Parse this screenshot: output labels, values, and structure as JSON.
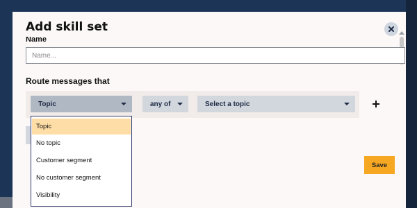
{
  "modal": {
    "title": "Add skill set",
    "close_icon": "close-icon"
  },
  "name_field": {
    "label": "Name",
    "placeholder": "Name...",
    "value": ""
  },
  "routing": {
    "label": "Route messages that",
    "condition_type": {
      "selected": "Topic",
      "icon": "chevron-down-icon"
    },
    "match_mode": {
      "selected": "any of",
      "icon": "chevron-down-icon"
    },
    "topic_picker": {
      "placeholder": "Select a topic",
      "icon": "chevron-down-icon"
    },
    "add_icon": "plus-icon",
    "condition_options": [
      "Topic",
      "No topic",
      "Customer segment",
      "No customer segment",
      "Visibility"
    ],
    "selected_option": "Topic"
  },
  "actions": {
    "save_label": "Save"
  },
  "colors": {
    "backdrop": "#1c3557",
    "modal_bg": "#fbf8f7",
    "select_bg": "#d2d6dd",
    "highlight": "#fedda6",
    "save_bg": "#f6a823"
  }
}
